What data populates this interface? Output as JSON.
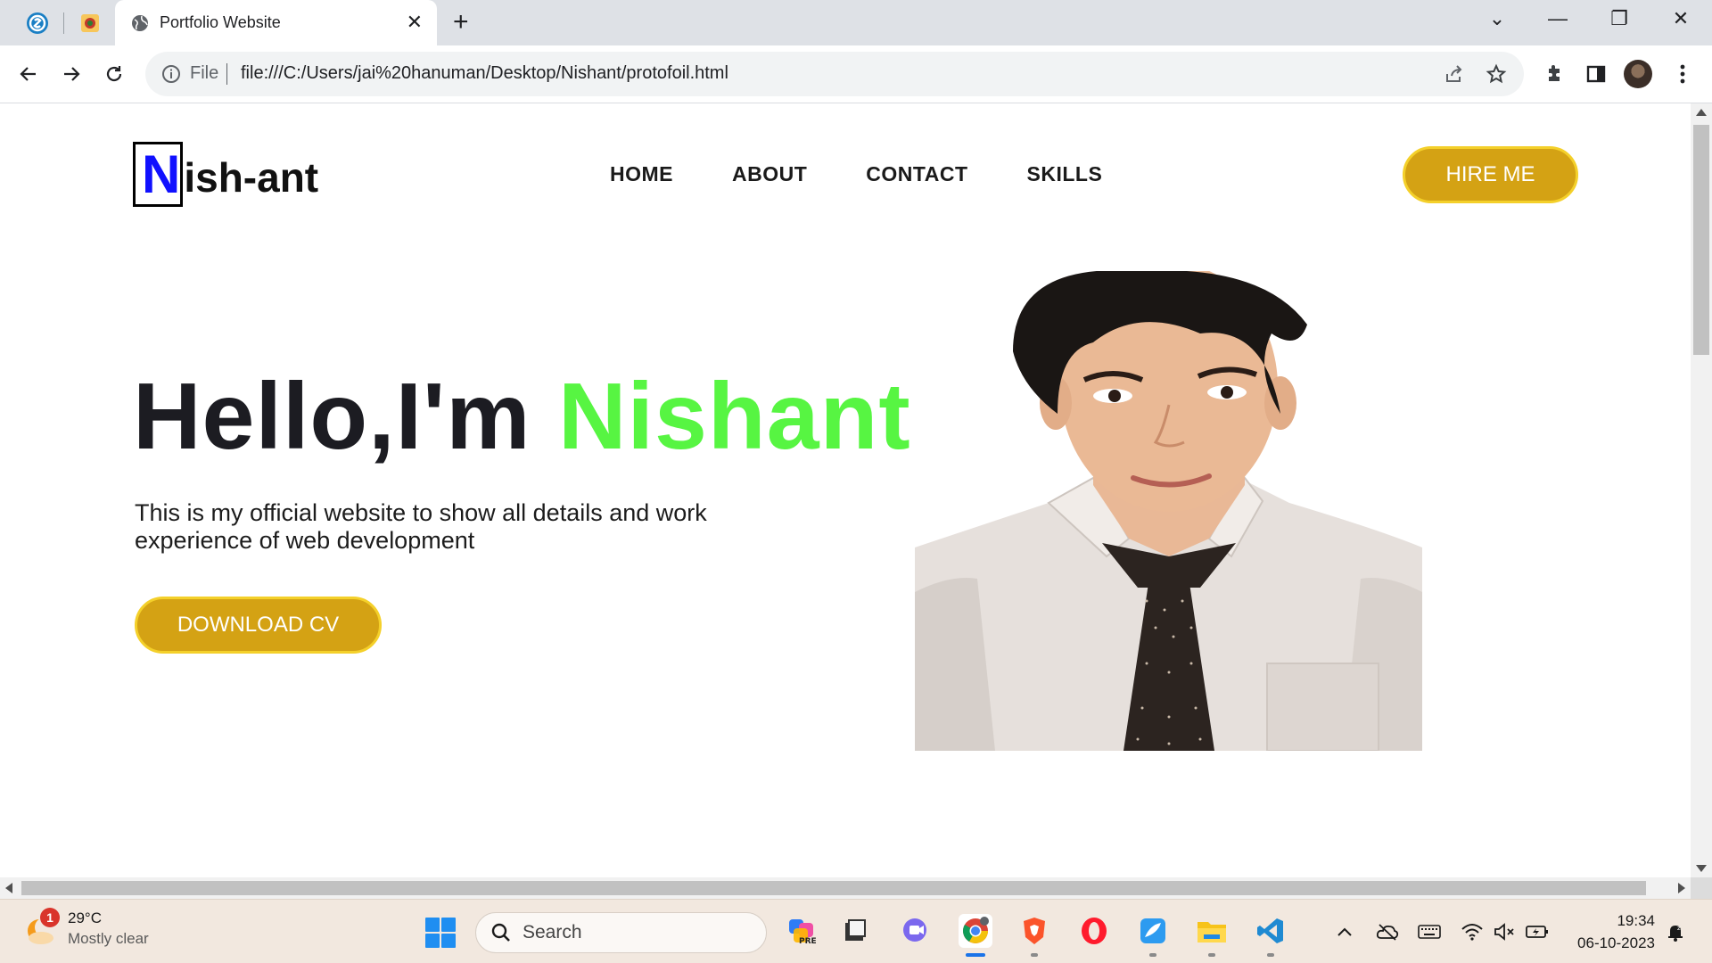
{
  "browser": {
    "tab_title": "Portfolio Website",
    "tab_close": "✕",
    "new_tab": "+",
    "url_scheme_label": "File",
    "url": "file:///C:/Users/jai%20hanuman/Desktop/Nishant/protofoil.html",
    "window_controls": {
      "dropdown": "⌄",
      "minimize": "—",
      "restore": "❐",
      "close": "✕"
    }
  },
  "site": {
    "logo_letter": "N",
    "logo_rest": "ish-ant",
    "nav": [
      "HOME",
      "ABOUT",
      "CONTACT",
      "SKILLS"
    ],
    "hire_button": "HIRE ME",
    "hero_greeting": "Hello,I'm ",
    "hero_name": "Nishant",
    "hero_description": "This is my official website to show all details and work experience of web development",
    "cv_button": "DOWNLOAD CV",
    "accent_color": "#57f542",
    "button_color": "#d4a214"
  },
  "taskbar": {
    "weather_badge": "1",
    "weather_temp": "29°C",
    "weather_desc": "Mostly clear",
    "search_label": "Search",
    "apps": [
      "copilot-icon",
      "file-viewer-icon",
      "teams-icon",
      "chrome-icon",
      "brave-icon",
      "opera-icon",
      "paint-icon",
      "file-explorer-icon",
      "vscode-icon"
    ],
    "clock_time": "19:34",
    "clock_date": "06-10-2023"
  }
}
